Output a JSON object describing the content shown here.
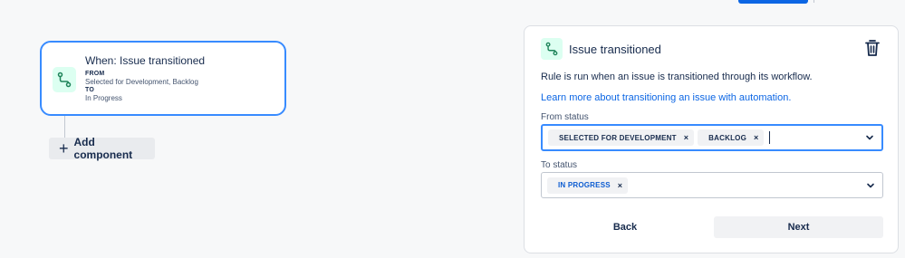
{
  "trigger": {
    "icon": "transition-icon",
    "title": "When: Issue transitioned",
    "from_label": "FROM",
    "from_value": "Selected for Development, Backlog",
    "to_label": "TO",
    "to_value": "In Progress"
  },
  "add_component": {
    "label": "Add component",
    "icon": "plus-icon"
  },
  "panel": {
    "icon": "transition-icon",
    "title": "Issue transitioned",
    "description": "Rule is run when an issue is transitioned through its workflow.",
    "link": "Learn more about transitioning an issue with automation.",
    "from_status": {
      "label": "From status",
      "chips": [
        "SELECTED FOR DEVELOPMENT",
        "BACKLOG"
      ]
    },
    "to_status": {
      "label": "To status",
      "chips": [
        "IN PROGRESS"
      ]
    },
    "back_label": "Back",
    "next_label": "Next"
  },
  "colors": {
    "accent": "#388bff",
    "link": "#0c66e4",
    "icon_bg": "#dcfff1",
    "icon_fg": "#1f845a"
  }
}
